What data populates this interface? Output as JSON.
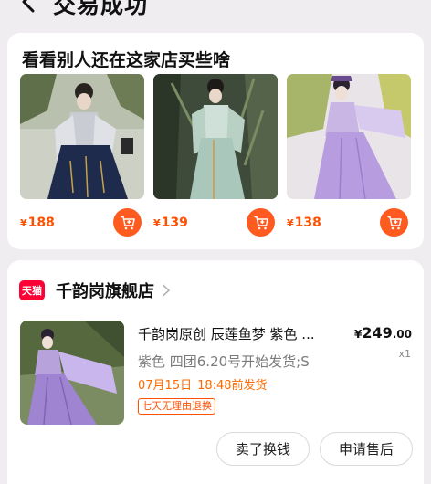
{
  "header": {
    "title": "交易成功",
    "back_icon": "back-arrow-icon",
    "more_icon": "more-icon"
  },
  "recommendations": {
    "title": "看看别人还在这家店买些啥",
    "currency": "¥",
    "items": [
      {
        "price": "188",
        "image": "hanfu-navy-gray"
      },
      {
        "price": "139",
        "image": "hanfu-mint-green"
      },
      {
        "price": "138",
        "image": "hanfu-lavender"
      }
    ]
  },
  "order": {
    "shop_badge": "天猫",
    "shop_name": "千韵岗旗舰店",
    "product": {
      "title": "千韵岗原创 辰莲鱼梦 紫色 ...",
      "sku": "紫色 四团6.20号开始发货;S",
      "ship_date": "07月15日",
      "ship_time": "18:48前发货",
      "return_policy": "七天无理由退换",
      "currency": "¥",
      "price_int": "249",
      "price_dec": ".00",
      "quantity": "x1"
    },
    "buttons": {
      "sell": "卖了换钱",
      "after_sale": "申请售后"
    }
  },
  "colors": {
    "accent": "#ff5000",
    "tmall": "#ff0036",
    "background": "#efedf0"
  }
}
